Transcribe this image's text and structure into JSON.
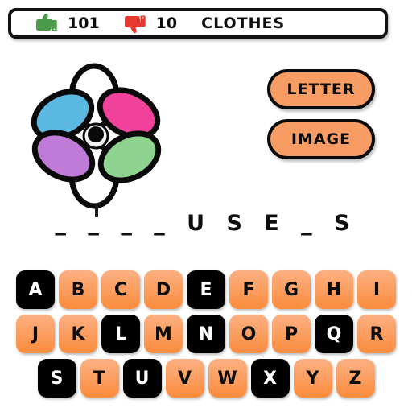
{
  "status_bar": {
    "thumbs_up_icon": "thumbs-up-icon",
    "likes": "101",
    "thumbs_down_icon": "thumbs-down-icon",
    "dislikes": "10",
    "category": "CLOTHES",
    "like_color": "#4a9a4a",
    "dislike_color": "#e8392e"
  },
  "puzzle_image": {
    "icon": "flower-pinwheel-icon",
    "petal_colors": {
      "top": "#ffffff",
      "upper_right": "#f0429a",
      "lower_right": "#8fd391",
      "bottom": "#ffffff",
      "lower_left": "#c07ad8",
      "upper_left": "#5bb8e0"
    },
    "center_color": "#0a0a0a",
    "stem_color": "#1a1a1a"
  },
  "actions": {
    "letter_label": "LETTER",
    "image_label": "IMAGE",
    "button_color": "#f79c63"
  },
  "word": {
    "display": "_ _ _ _ U S E _ S",
    "length": 9
  },
  "keyboard": {
    "rows": [
      [
        {
          "letter": "A",
          "state": "used"
        },
        {
          "letter": "B",
          "state": "available"
        },
        {
          "letter": "C",
          "state": "available"
        },
        {
          "letter": "D",
          "state": "available"
        },
        {
          "letter": "E",
          "state": "used"
        },
        {
          "letter": "F",
          "state": "available"
        },
        {
          "letter": "G",
          "state": "available"
        },
        {
          "letter": "H",
          "state": "available"
        },
        {
          "letter": "I",
          "state": "available"
        }
      ],
      [
        {
          "letter": "J",
          "state": "available"
        },
        {
          "letter": "K",
          "state": "available"
        },
        {
          "letter": "L",
          "state": "used"
        },
        {
          "letter": "M",
          "state": "available"
        },
        {
          "letter": "N",
          "state": "used"
        },
        {
          "letter": "O",
          "state": "available"
        },
        {
          "letter": "P",
          "state": "available"
        },
        {
          "letter": "Q",
          "state": "used"
        },
        {
          "letter": "R",
          "state": "available"
        }
      ],
      [
        {
          "letter": "S",
          "state": "used"
        },
        {
          "letter": "T",
          "state": "available"
        },
        {
          "letter": "U",
          "state": "used"
        },
        {
          "letter": "V",
          "state": "available"
        },
        {
          "letter": "W",
          "state": "available"
        },
        {
          "letter": "X",
          "state": "used"
        },
        {
          "letter": "Y",
          "state": "available"
        },
        {
          "letter": "Z",
          "state": "available"
        }
      ]
    ]
  }
}
